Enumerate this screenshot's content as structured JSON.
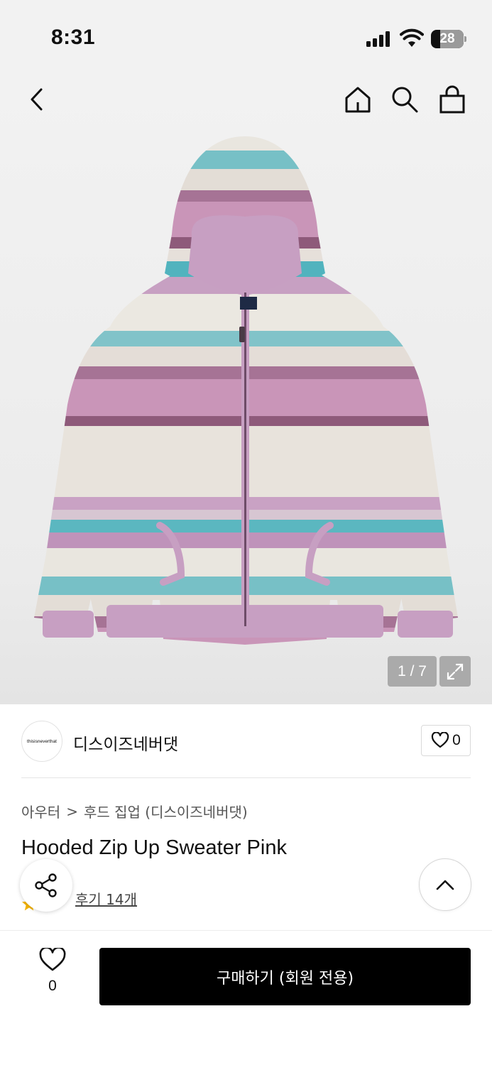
{
  "status_bar": {
    "time": "8:31",
    "battery": "28",
    "battery_level": 0.28
  },
  "header": {
    "back_icon": "chevron-left-icon",
    "home_icon": "home-icon",
    "search_icon": "search-icon",
    "cart_icon": "shopping-bag-icon"
  },
  "gallery": {
    "counter": "1 / 7",
    "expand_icon": "expand-icon"
  },
  "brand": {
    "logo_text": "thisisneverthat",
    "name": "디스이즈네버댓",
    "like_count": "0"
  },
  "breadcrumb": {
    "category": "아우터",
    "separator": ">",
    "subcategory": "후드 집업 (디스이즈네버댓)"
  },
  "product": {
    "title": "Hooded Zip Up Sweater Pink",
    "review_link": "후기 14개"
  },
  "bottom": {
    "wish_count": "0",
    "buy_label": "구매하기 (회원 전용)"
  },
  "colors": {
    "accent": "#000000",
    "knit_pink": "#c79fc2",
    "knit_teal": "#2aa6b5",
    "knit_cream": "#ebe7df",
    "knit_plum": "#8e5a7a",
    "star": "#f5b400"
  }
}
